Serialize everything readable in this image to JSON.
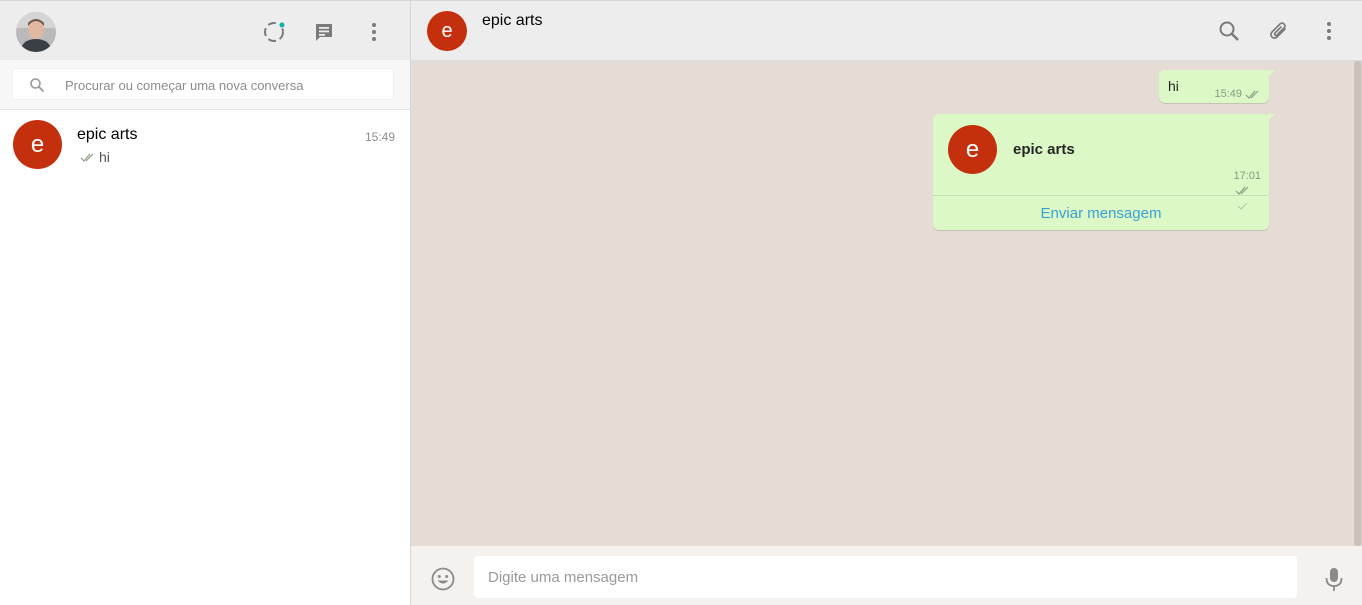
{
  "sidebar": {
    "search": {
      "placeholder": "Procurar ou começar uma nova conversa"
    },
    "chats": [
      {
        "initial": "e",
        "name": "epic arts",
        "time": "15:49",
        "preview": "hi"
      }
    ],
    "icons": [
      "status-icon",
      "new-chat-icon",
      "menu-icon",
      "search-icon"
    ]
  },
  "conversation": {
    "header": {
      "initial": "e",
      "name": "epic arts",
      "icons": [
        "search-icon",
        "attach-icon",
        "menu-icon"
      ]
    },
    "messages": [
      {
        "type": "text",
        "text": "hi",
        "time": "15:49",
        "status": "read"
      },
      {
        "type": "contact",
        "initial": "e",
        "name": "epic arts",
        "time": "17:01",
        "action": "Enviar mensagem"
      }
    ],
    "composer": {
      "placeholder": "Digite uma mensagem"
    }
  },
  "colors": {
    "avatar": "#c4300e",
    "outgoing_bubble": "#dcf8c6",
    "chat_background": "#e4dcd5",
    "link": "#3aa0d3",
    "status_dot": "#09b3a2"
  }
}
